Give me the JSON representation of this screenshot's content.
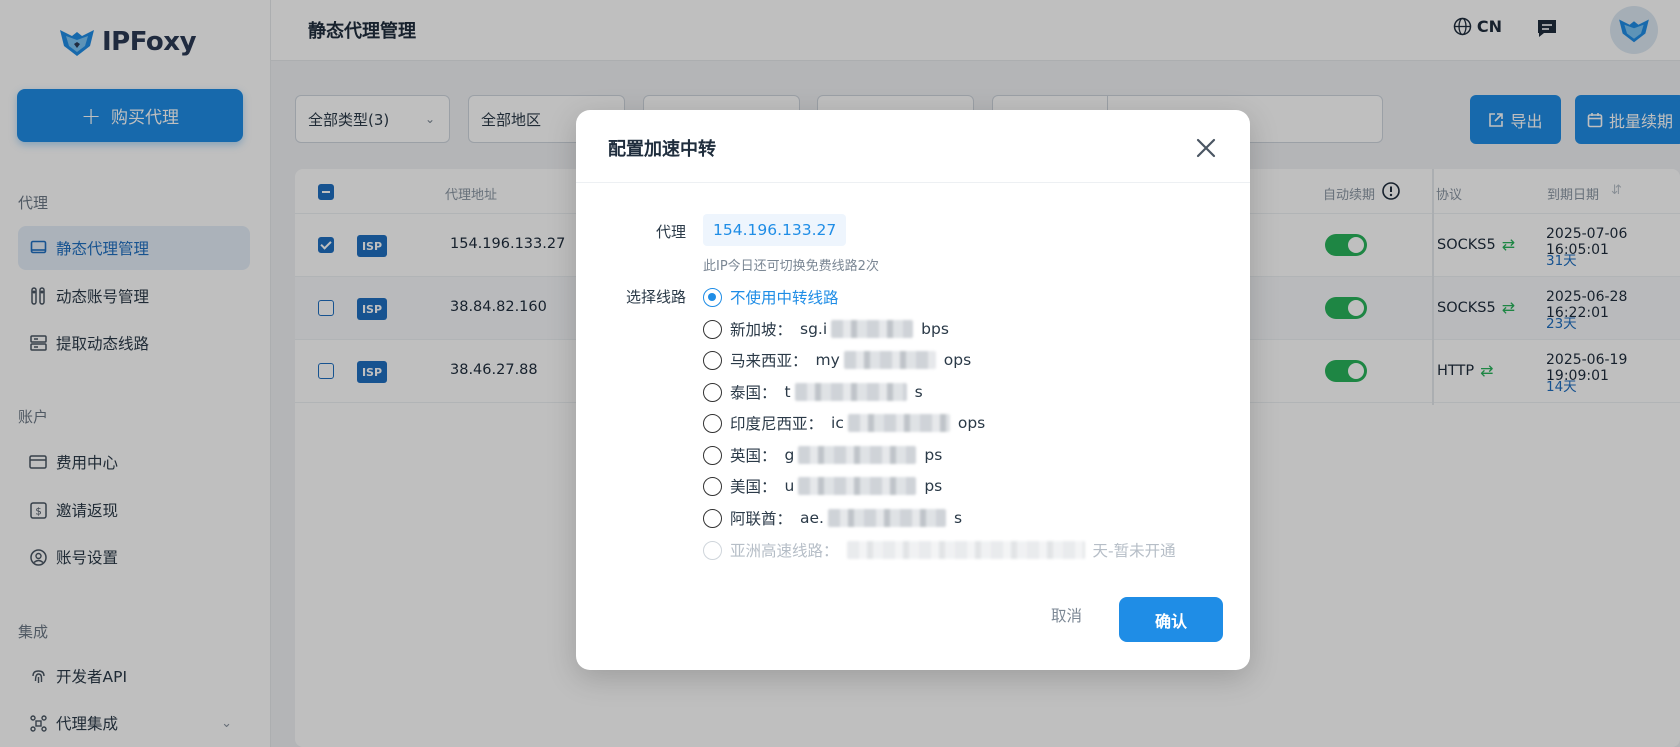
{
  "app": {
    "name": "IPFoxy"
  },
  "sidebar": {
    "buy_label": "购买代理",
    "sections": [
      {
        "label": "代理",
        "items": [
          {
            "label": "静态代理管理",
            "icon": "laptop-icon"
          },
          {
            "label": "动态账号管理",
            "icon": "sliders-icon"
          },
          {
            "label": "提取动态线路",
            "icon": "server-icon"
          }
        ]
      },
      {
        "label": "账户",
        "items": [
          {
            "label": "费用中心",
            "icon": "card-icon"
          },
          {
            "label": "邀请返现",
            "icon": "dollar-icon"
          },
          {
            "label": "账号设置",
            "icon": "user-icon"
          }
        ]
      },
      {
        "label": "集成",
        "items": [
          {
            "label": "开发者API",
            "icon": "fingerprint-icon"
          },
          {
            "label": "代理集成",
            "icon": "integration-icon"
          }
        ]
      }
    ]
  },
  "header": {
    "title": "静态代理管理",
    "lang": "CN"
  },
  "filters": {
    "type_select": "全部类型(3)",
    "region_select": "全部地区",
    "export_label": "导出",
    "renew_label": "批量续期"
  },
  "table": {
    "columns": {
      "address": "代理地址",
      "auto_renew": "自动续期",
      "protocol": "协议",
      "expiry": "到期日期"
    },
    "rows": [
      {
        "checked": true,
        "badge": "ISP",
        "address": "154.196.133.27",
        "auto_renew": true,
        "protocol": "SOCKS5",
        "expiry": "2025-07-06 16:05:01",
        "days": "31天"
      },
      {
        "checked": false,
        "badge": "ISP",
        "address": "38.84.82.160",
        "auto_renew": true,
        "protocol": "SOCKS5",
        "expiry": "2025-06-28 16:22:01",
        "days": "23天"
      },
      {
        "checked": false,
        "badge": "ISP",
        "address": "38.46.27.88",
        "auto_renew": true,
        "protocol": "HTTP",
        "expiry": "2025-06-19 19:09:01",
        "days": "14天"
      }
    ]
  },
  "modal": {
    "title": "配置加速中转",
    "proxy_label": "代理",
    "proxy_value": "154.196.133.27",
    "hint": "此IP今日还可切换免费线路2次",
    "route_label": "选择线路",
    "options": [
      {
        "label": "不使用中转线路",
        "state": "selected",
        "prefix": "",
        "suffix": ""
      },
      {
        "label": "新加坡：",
        "state": "normal",
        "prefix": "sg.i",
        "suffix": "bps"
      },
      {
        "label": "马来西亚：",
        "state": "normal",
        "prefix": "my",
        "suffix": "ops"
      },
      {
        "label": "泰国：",
        "state": "normal",
        "prefix": "t",
        "suffix": "s"
      },
      {
        "label": "印度尼西亚：",
        "state": "normal",
        "prefix": "ic",
        "suffix": "ops"
      },
      {
        "label": "英国：",
        "state": "normal",
        "prefix": "g",
        "suffix": "ps"
      },
      {
        "label": "美国：",
        "state": "normal",
        "prefix": "u",
        "suffix": "ps"
      },
      {
        "label": "阿联酋：",
        "state": "normal",
        "prefix": "ae.",
        "suffix": "s"
      },
      {
        "label": "亚洲高速线路：",
        "state": "disabled",
        "prefix": "",
        "suffix": "天-暂未开通"
      }
    ],
    "cancel_label": "取消",
    "confirm_label": "确认"
  },
  "colors": {
    "primary": "#1f8de6",
    "success": "#28b35b",
    "overlay": "rgba(0,0,0,0.25)"
  }
}
